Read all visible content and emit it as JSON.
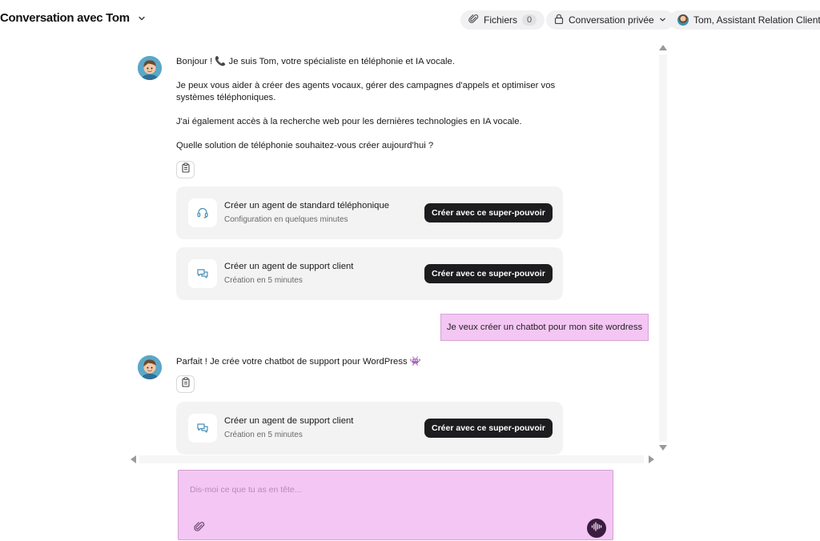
{
  "header": {
    "title": "Conversation avec Tom",
    "files_label": "Fichiers",
    "files_count": "0",
    "privacy_label": "Conversation privée",
    "agent_label": "Tom, Assistant Relation Client"
  },
  "messages": {
    "first": {
      "greeting": "Bonjour ! 📞 Je suis Tom, votre spécialiste en téléphonie et IA vocale.",
      "p2": "Je peux vous aider à créer des agents vocaux, gérer des campagnes d'appels et optimiser vos systèmes téléphoniques.",
      "p3": "J'ai également accès à la recherche web pour les dernières technologies en IA vocale.",
      "p4": "Quelle solution de téléphonie souhaitez-vous créer aujourd'hui ?"
    },
    "user": "Je veux créer un chatbot pour mon site wordress",
    "second": {
      "text": "Parfait ! Je crée votre chatbot de support pour WordPress 👾"
    }
  },
  "cards": [
    {
      "icon": "headset-icon",
      "title": "Créer un agent de standard téléphonique",
      "subtitle": "Configuration en quelques minutes",
      "button": "Créer avec ce super-pouvoir"
    },
    {
      "icon": "chat-bubbles-icon",
      "title": "Créer un agent de support client",
      "subtitle": "Création en 5 minutes",
      "button": "Créer avec ce super-pouvoir"
    },
    {
      "icon": "chat-bubbles-icon",
      "title": "Créer un agent de support client",
      "subtitle": "Création en 5 minutes",
      "button": "Créer avec ce super-pouvoir"
    }
  ],
  "composer": {
    "placeholder": "Dis-moi ce que tu as en tête..."
  },
  "colors": {
    "accent_pink": "#f4c6f4",
    "button_dark": "#1d1d1f",
    "icon_blue": "#4a8fb5",
    "voice_button": "#3a1c3f"
  }
}
